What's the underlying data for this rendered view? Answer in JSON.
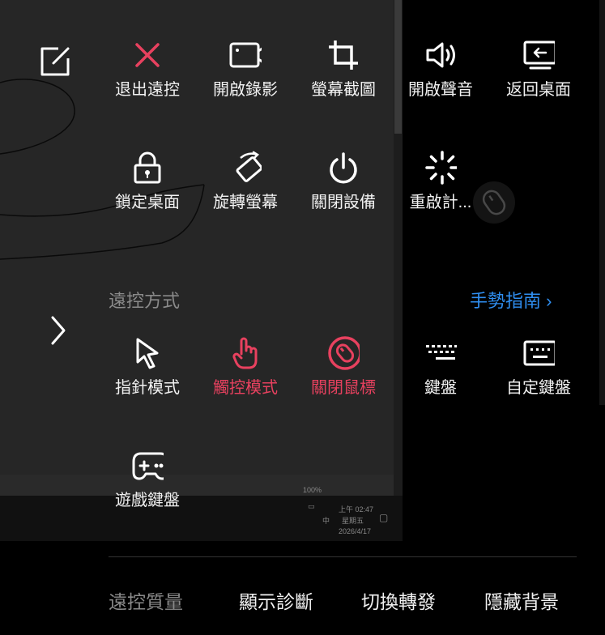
{
  "top_actions": [
    {
      "label": "退出遠控",
      "icon": "close-icon"
    },
    {
      "label": "開啟錄影",
      "icon": "video-camera-icon"
    },
    {
      "label": "螢幕截圖",
      "icon": "crop-icon"
    },
    {
      "label": "開啟聲音",
      "icon": "speaker-icon"
    },
    {
      "label": "返回桌面",
      "icon": "desktop-return-icon"
    }
  ],
  "second_actions": [
    {
      "label": "鎖定桌面",
      "icon": "lock-icon"
    },
    {
      "label": "旋轉螢幕",
      "icon": "rotate-screen-icon"
    },
    {
      "label": "關閉設備",
      "icon": "power-icon"
    },
    {
      "label": "重啟計...",
      "icon": "loading-spinner-icon"
    }
  ],
  "control_section": {
    "title": "遠控方式",
    "gesture_link": "手勢指南 ›",
    "modes": [
      {
        "label": "指針模式",
        "icon": "pointer-icon",
        "active": false
      },
      {
        "label": "觸控模式",
        "icon": "touch-hand-icon",
        "active": true
      },
      {
        "label": "關閉鼠標",
        "icon": "mouse-off-icon",
        "active": true
      },
      {
        "label": "鍵盤",
        "icon": "keyboard-icon",
        "active": false
      },
      {
        "label": "自定鍵盤",
        "icon": "custom-keyboard-icon",
        "active": false
      }
    ],
    "extra": [
      {
        "label": "遊戲鍵盤",
        "icon": "gamepad-icon"
      }
    ]
  },
  "bottom_bar": {
    "quality": "遠控質量",
    "items": [
      "顯示診斷",
      "切換轉發",
      "隱藏背景"
    ]
  },
  "remote_screen": {
    "zoom": "100%",
    "time": "上午 02:47",
    "weekday": "星期五",
    "date": "2026/4/17",
    "ime": "中"
  },
  "colors": {
    "accent_red": "#e8415f",
    "link_blue": "#2f8ef0"
  }
}
